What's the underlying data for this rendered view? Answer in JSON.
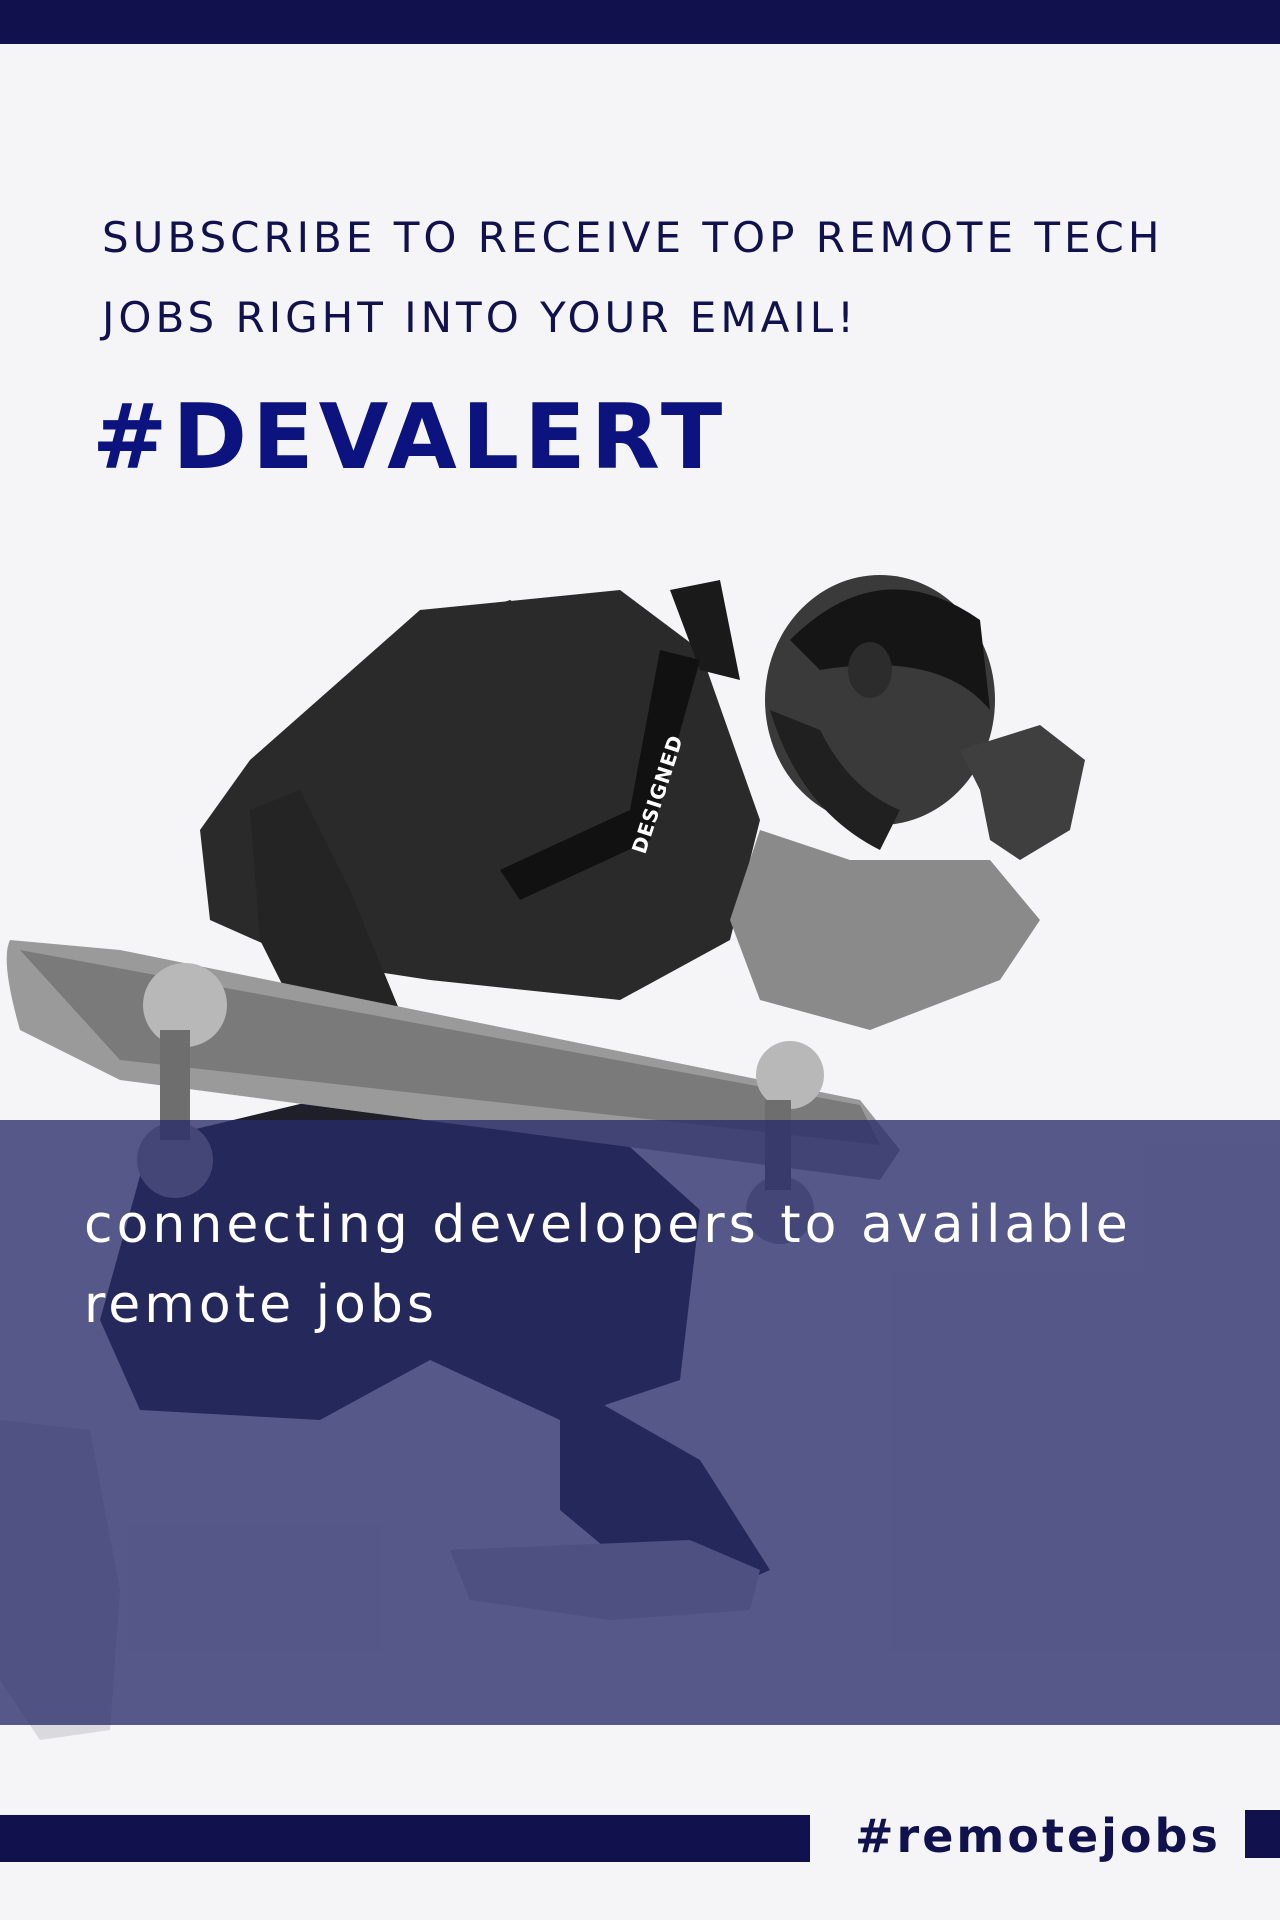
{
  "poster": {
    "subscribe_text": "SUBSCRIBE TO RECEIVE TOP REMOTE TECH JOBS RIGHT INTO YOUR EMAIL!",
    "title": "#DEVALERT",
    "tagline": "connecting developers to available remote jobs",
    "bottom_hashtag": "#remotejobs",
    "jacket_strap_text": "DESIGNED"
  },
  "colors": {
    "navy": "#11124d",
    "title_blue": "#0d137e",
    "overlay": "#282b69",
    "background": "#f5f5f7"
  }
}
